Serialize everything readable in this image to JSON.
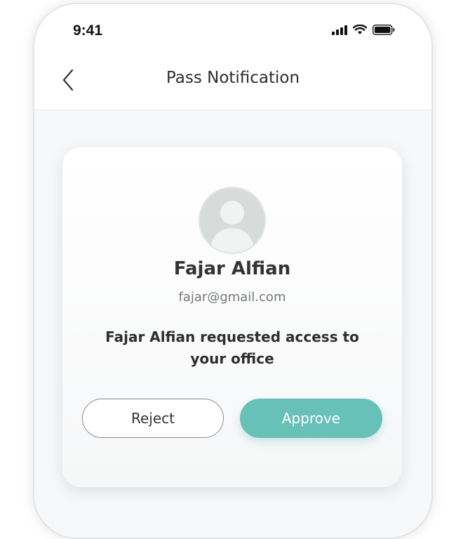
{
  "status_bar": {
    "time": "9:41",
    "icons": [
      "signal-icon",
      "wifi-icon",
      "battery-icon"
    ]
  },
  "header": {
    "back_icon": "chevron-left-icon",
    "title": "Pass Notification"
  },
  "request": {
    "avatar_icon": "user-avatar-placeholder",
    "name": "Fajar Alfian",
    "email": "fajar@gmail.com",
    "message": "Fajar Alfian requested access to your office"
  },
  "actions": {
    "reject_label": "Reject",
    "approve_label": "Approve"
  },
  "colors": {
    "accent": "#67c1b8",
    "text_dark": "#333333",
    "text_muted": "#777777",
    "avatar_bg": "#d7dcdb"
  }
}
